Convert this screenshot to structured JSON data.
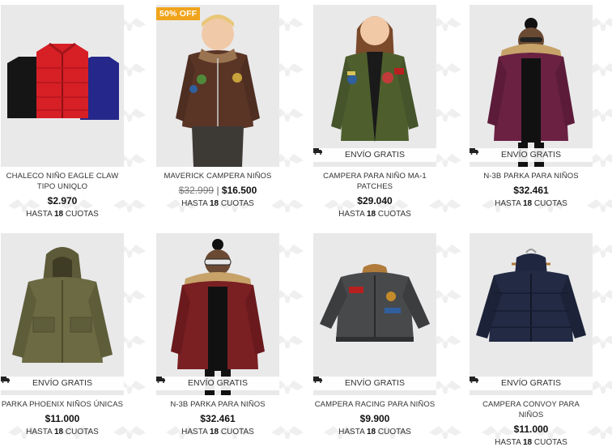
{
  "products": [
    {
      "name": "CHALECO NIÑO EAGLE CLAW TIPO UNIQLO",
      "price": "$2.970",
      "installments": {
        "prefix": "HASTA",
        "count": "18",
        "suffix": "CUOTAS"
      },
      "badge": "",
      "old_price": "",
      "shipping": ""
    },
    {
      "name": "MAVERICK CAMPERA NIÑOS",
      "price": "$16.500",
      "old_price": "$32.999",
      "badge": "50% OFF",
      "installments": {
        "prefix": "HASTA",
        "count": "18",
        "suffix": "CUOTAS"
      },
      "shipping": ""
    },
    {
      "name": "CAMPERA PARA NIÑO MA-1 PATCHES",
      "price": "$29.040",
      "shipping": "ENVÍO GRATIS",
      "installments": {
        "prefix": "HASTA",
        "count": "18",
        "suffix": "CUOTAS"
      },
      "badge": "",
      "old_price": ""
    },
    {
      "name": "N-3B PARKA PARA NIÑOS",
      "price": "$32.461",
      "shipping": "ENVÍO GRATIS",
      "installments": {
        "prefix": "HASTA",
        "count": "18",
        "suffix": "CUOTAS"
      },
      "badge": "",
      "old_price": ""
    },
    {
      "name": "PARKA PHOENIX NIÑOS ÚNICAS",
      "price": "$11.000",
      "shipping": "ENVÍO GRATIS",
      "installments": {
        "prefix": "HASTA",
        "count": "18",
        "suffix": "CUOTAS"
      },
      "badge": "",
      "old_price": ""
    },
    {
      "name": "N-3B PARKA PARA NIÑOS",
      "price": "$32.461",
      "shipping": "ENVÍO GRATIS",
      "installments": {
        "prefix": "HASTA",
        "count": "18",
        "suffix": "CUOTAS"
      },
      "badge": "",
      "old_price": ""
    },
    {
      "name": "CAMPERA RACING PARA NIÑOS",
      "price": "$9.900",
      "shipping": "ENVÍO GRATIS",
      "installments": {
        "prefix": "HASTA",
        "count": "18",
        "suffix": "CUOTAS"
      },
      "badge": "",
      "old_price": ""
    },
    {
      "name": "CAMPERA CONVOY PARA NIÑOS",
      "price": "$11.000",
      "shipping": "ENVÍO GRATIS",
      "installments": {
        "prefix": "HASTA",
        "count": "18",
        "suffix": "CUOTAS"
      },
      "badge": "",
      "old_price": ""
    }
  ],
  "icons": {
    "shipping": "truck-icon"
  },
  "colors": {
    "badge": "#f0a41b",
    "image_bg": "#e9e9ea",
    "pattern": "#ececec"
  }
}
